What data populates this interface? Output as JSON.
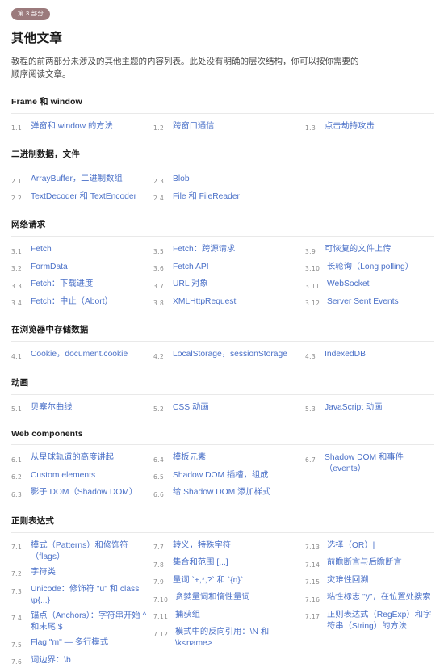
{
  "header": {
    "badge": "第 3 部分",
    "title": "其他文章",
    "intro": "教程的前两部分未涉及的其他主题的内容列表。此处没有明确的层次结构，你可以按你需要的顺序阅读文章。"
  },
  "sections": [
    {
      "title": "Frame 和 window",
      "columns": [
        [
          {
            "num": "1.1",
            "label": "弹窗和 window 的方法"
          }
        ],
        [
          {
            "num": "1.2",
            "label": "跨窗口通信"
          }
        ],
        [
          {
            "num": "1.3",
            "label": "点击劫持攻击"
          }
        ]
      ]
    },
    {
      "title": "二进制数据，文件",
      "columns": [
        [
          {
            "num": "2.1",
            "label": "ArrayBuffer，二进制数组"
          },
          {
            "num": "2.2",
            "label": "TextDecoder 和 TextEncoder"
          }
        ],
        [
          {
            "num": "2.3",
            "label": "Blob"
          },
          {
            "num": "2.4",
            "label": "File 和 FileReader"
          }
        ],
        []
      ]
    },
    {
      "title": "网络请求",
      "columns": [
        [
          {
            "num": "3.1",
            "label": "Fetch"
          },
          {
            "num": "3.2",
            "label": "FormData"
          },
          {
            "num": "3.3",
            "label": "Fetch：下载进度"
          },
          {
            "num": "3.4",
            "label": "Fetch：中止（Abort）"
          }
        ],
        [
          {
            "num": "3.5",
            "label": "Fetch：跨源请求"
          },
          {
            "num": "3.6",
            "label": "Fetch API"
          },
          {
            "num": "3.7",
            "label": "URL 对象"
          },
          {
            "num": "3.8",
            "label": "XMLHttpRequest"
          }
        ],
        [
          {
            "num": "3.9",
            "label": "可恢复的文件上传"
          },
          {
            "num": "3.10",
            "label": "长轮询（Long polling）"
          },
          {
            "num": "3.11",
            "label": "WebSocket"
          },
          {
            "num": "3.12",
            "label": "Server Sent Events"
          }
        ]
      ]
    },
    {
      "title": "在浏览器中存储数据",
      "columns": [
        [
          {
            "num": "4.1",
            "label": "Cookie，document.cookie"
          }
        ],
        [
          {
            "num": "4.2",
            "label": "LocalStorage，sessionStorage"
          }
        ],
        [
          {
            "num": "4.3",
            "label": "IndexedDB"
          }
        ]
      ]
    },
    {
      "title": "动画",
      "columns": [
        [
          {
            "num": "5.1",
            "label": "贝塞尔曲线"
          }
        ],
        [
          {
            "num": "5.2",
            "label": "CSS 动画"
          }
        ],
        [
          {
            "num": "5.3",
            "label": "JavaScript 动画"
          }
        ]
      ]
    },
    {
      "title": "Web components",
      "columns": [
        [
          {
            "num": "6.1",
            "label": "从星球轨道的高度讲起"
          },
          {
            "num": "6.2",
            "label": "Custom elements"
          },
          {
            "num": "6.3",
            "label": "影子 DOM（Shadow DOM）"
          }
        ],
        [
          {
            "num": "6.4",
            "label": "模板元素"
          },
          {
            "num": "6.5",
            "label": "Shadow DOM 插槽，组成"
          },
          {
            "num": "6.6",
            "label": "给 Shadow DOM 添加样式"
          }
        ],
        [
          {
            "num": "6.7",
            "label": "Shadow DOM 和事件（events）"
          }
        ]
      ]
    },
    {
      "title": "正则表达式",
      "columns": [
        [
          {
            "num": "7.1",
            "label": "模式（Patterns）和修饰符（flags）"
          },
          {
            "num": "7.2",
            "label": "字符类"
          },
          {
            "num": "7.3",
            "label": "Unicode：修饰符 \"u\" 和 class \\p{...}"
          },
          {
            "num": "7.4",
            "label": "锚点（Anchors）：字符串开始 ^ 和末尾 $"
          },
          {
            "num": "7.5",
            "label": "Flag \"m\" — 多行模式"
          },
          {
            "num": "7.6",
            "label": "词边界：\\b"
          }
        ],
        [
          {
            "num": "7.7",
            "label": "转义，特殊字符"
          },
          {
            "num": "7.8",
            "label": "集合和范围 [...]"
          },
          {
            "num": "7.9",
            "label": "量词 `+,*,?` 和 `{n}`"
          },
          {
            "num": "7.10",
            "label": "贪婪量词和惰性量词"
          },
          {
            "num": "7.11",
            "label": "捕获组"
          },
          {
            "num": "7.12",
            "label": "模式中的反向引用：\\N 和 \\k<name>"
          }
        ],
        [
          {
            "num": "7.13",
            "label": "选择（OR）|"
          },
          {
            "num": "7.14",
            "label": "前瞻断言与后瞻断言"
          },
          {
            "num": "7.15",
            "label": "灾难性回溯"
          },
          {
            "num": "7.16",
            "label": "粘性标志 \"y\"，在位置处搜索"
          },
          {
            "num": "7.17",
            "label": "正则表达式（RegExp）和字符串（String）的方法"
          }
        ]
      ]
    }
  ]
}
